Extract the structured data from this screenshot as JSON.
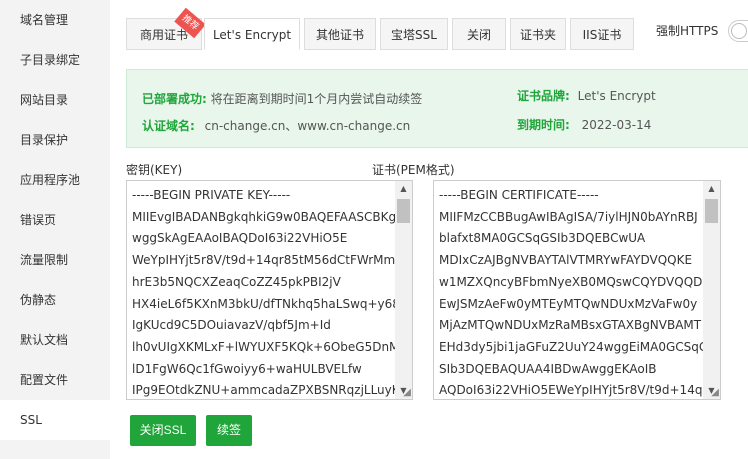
{
  "sidebar": {
    "items": [
      {
        "label": "域名管理"
      },
      {
        "label": "子目录绑定"
      },
      {
        "label": "网站目录"
      },
      {
        "label": "目录保护"
      },
      {
        "label": "应用程序池"
      },
      {
        "label": "错误页"
      },
      {
        "label": "流量限制"
      },
      {
        "label": "伪静态"
      },
      {
        "label": "默认文档"
      },
      {
        "label": "配置文件"
      },
      {
        "label": "SSL"
      }
    ],
    "active_index": 10
  },
  "tabs": {
    "items": [
      {
        "label": "商用证书",
        "badge": "推荐"
      },
      {
        "label": "Let's Encrypt"
      },
      {
        "label": "其他证书"
      },
      {
        "label": "宝塔SSL"
      },
      {
        "label": "关闭"
      },
      {
        "label": "证书夹"
      },
      {
        "label": "IIS证书"
      }
    ],
    "active_index": 1,
    "force_https_label": "强制HTTPS",
    "force_https_enabled": false
  },
  "info": {
    "deployed_label": "已部署成功:",
    "deployed_text": "将在距离到期时间1个月内尝试自动续签",
    "domain_label": "认证域名:",
    "domain_value": "cn-change.cn、www.cn-change.cn",
    "brand_label": "证书品牌:",
    "brand_value": "Let's Encrypt",
    "expiry_label": "到期时间:",
    "expiry_value": "2022-03-14"
  },
  "key": {
    "label": "密钥(KEY)",
    "lines": [
      "-----BEGIN PRIVATE KEY-----",
      "MIIEvgIBADANBgkqhkiG9w0BAQEFAASCBKg",
      "wggSkAgEAAoIBAQDoI63i22VHiO5E",
      "WeYpIHYjt5r8V/t9d+14qr85tM56dCtFWrMm",
      "hrE3b5NQCXZeaqCoZZ45pkPBI2jV",
      "HX4ieL6f5KXnM3bkU/dfTNkhq5haLSwq+y68",
      "IgKUcd9C5DOuiavazV/qbf5Jm+Id",
      "lh0vUIgXKMLxF+lWYUXF5KQk+6ObeG5DnM",
      "lD1FgW6Qc1fGwoiyy6+waHULBVELfw",
      "IPg9EOtdkZNU+ammcadaZPXBSNRqzjLLuyK"
    ]
  },
  "cert": {
    "label": "证书(PEM格式)",
    "lines": [
      "-----BEGIN CERTIFICATE-----",
      "MIIFMzCCBBugAwIBAgISA/7iylHJN0bAYnRBJ",
      "blafxt8MA0GCSqGSIb3DQEBCwUA",
      "MDIxCzAJBgNVBAYTAlVTMRYwFAYDVQQKE",
      "w1MZXQncyBFbmNyeXB0MQswCQYDVQQD",
      "EwJSMzAeFw0yMTEyMTQwNDUxMzVaFw0y",
      "MjAzMTQwNDUxMzRaMBsxGTAXBgNVBAMT",
      "EHd3dy5jbi1jaGFuZ2UuY24wggEiMA0GCSqG",
      "SIb3DQEBAQUAA4IBDwAwggEKAoIB",
      "AQDoI63i22VHiO5EWeYpIHYjt5r8V/t9d+14qr"
    ]
  },
  "actions": {
    "close_ssl_label": "关闭SSL",
    "renew_label": "续签"
  }
}
